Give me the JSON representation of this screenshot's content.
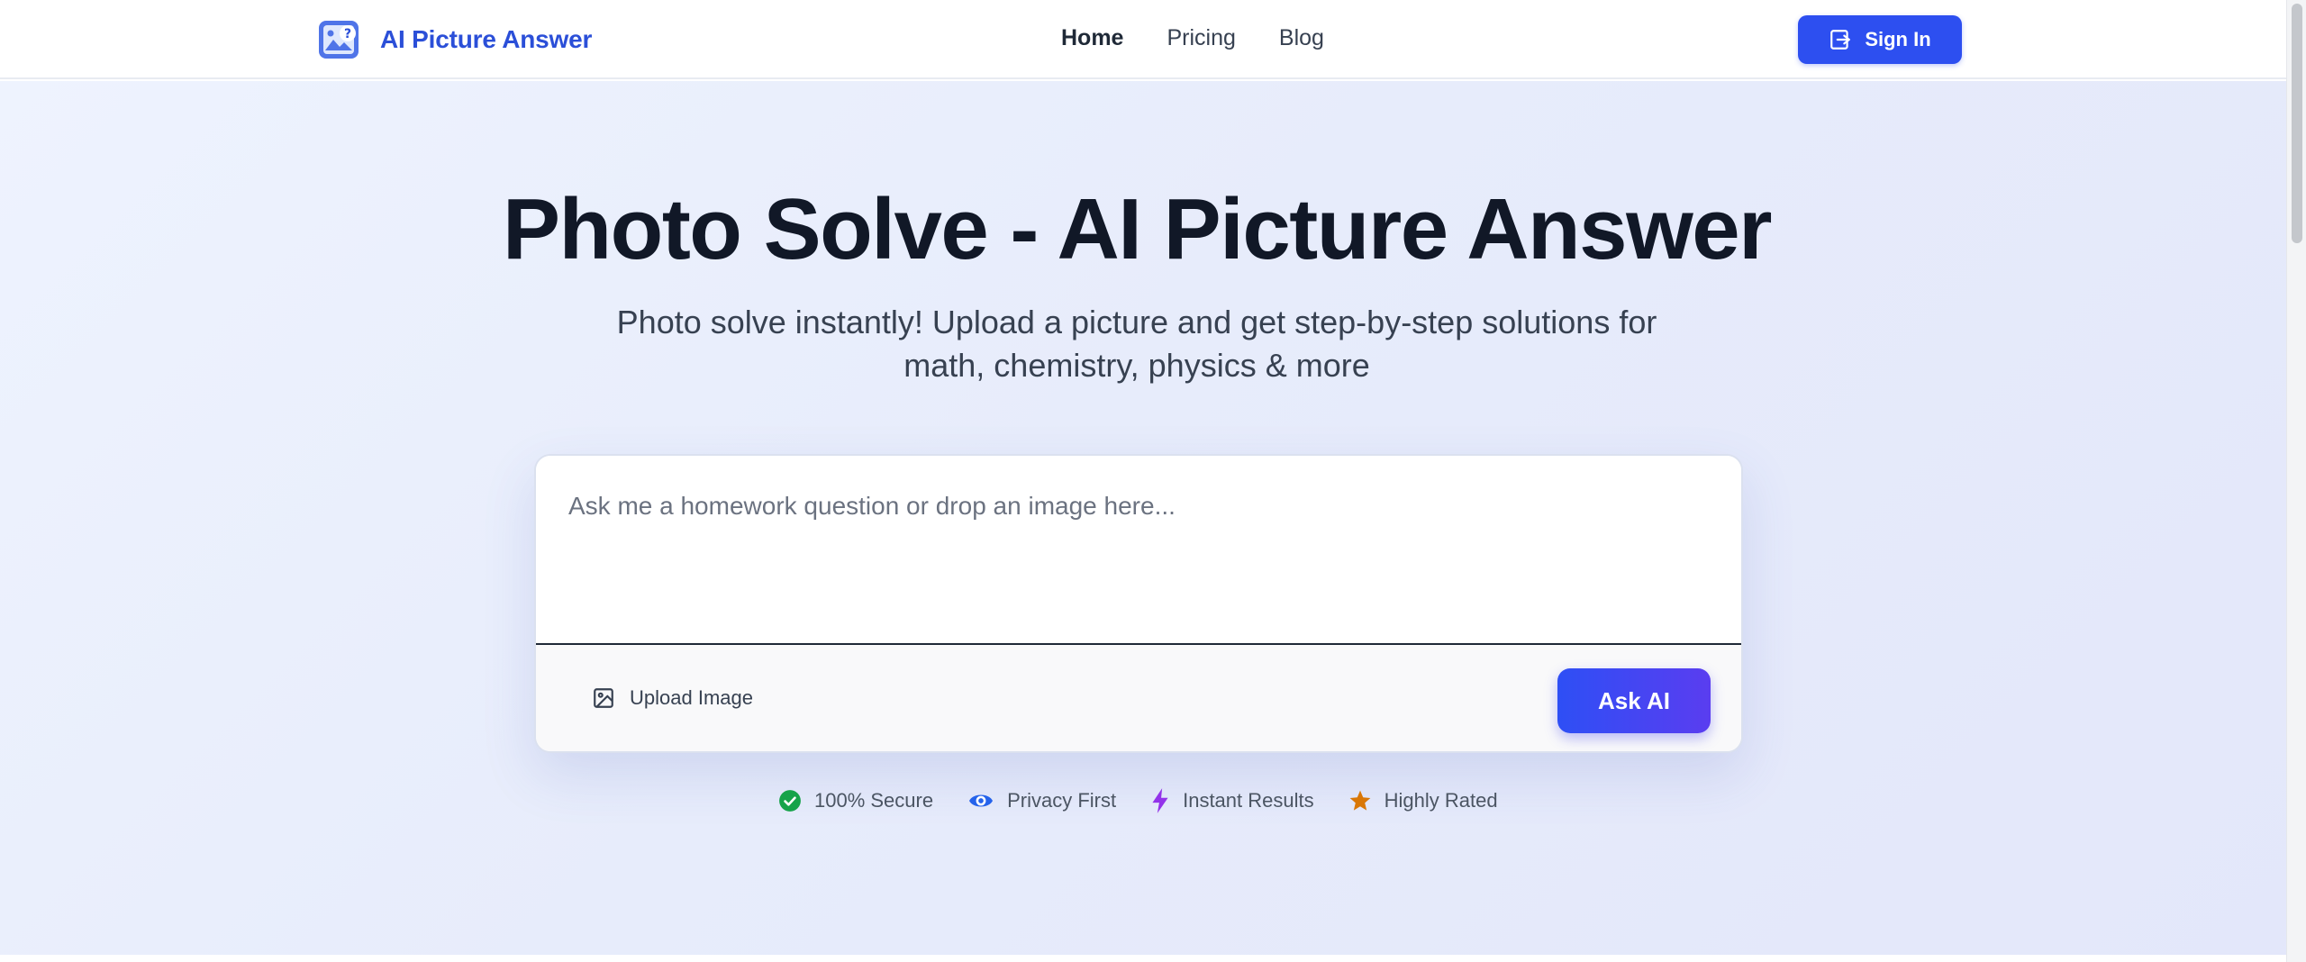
{
  "header": {
    "logo_text": "AI Picture Answer",
    "logo_icon": "picture-question-icon",
    "nav": [
      {
        "label": "Home"
      },
      {
        "label": "Pricing"
      },
      {
        "label": "Blog"
      }
    ],
    "sign_in_label": "Sign In",
    "sign_in_icon": "sign-in-icon"
  },
  "hero": {
    "title": "Photo Solve - AI Picture Answer",
    "subtitle": "Photo solve instantly! Upload a picture and get step-by-step solutions for math, chemistry, physics & more"
  },
  "question_box": {
    "placeholder": "Ask me a homework question or drop an image here...",
    "value": "",
    "upload_label": "Upload Image",
    "upload_icon": "image-icon",
    "ask_label": "Ask AI"
  },
  "badges": [
    {
      "label": "100% Secure",
      "icon": "check-circle-icon",
      "color": "#16a34a"
    },
    {
      "label": "Privacy First",
      "icon": "eye-icon",
      "color": "#2563eb"
    },
    {
      "label": "Instant Results",
      "icon": "lightning-icon",
      "color": "#9333ea"
    },
    {
      "label": "Highly Rated",
      "icon": "star-icon",
      "color": "#d97706"
    }
  ],
  "colors": {
    "brand": "#2b4fd8",
    "primary_button": "#2d4ff0",
    "title_text": "#111827"
  }
}
